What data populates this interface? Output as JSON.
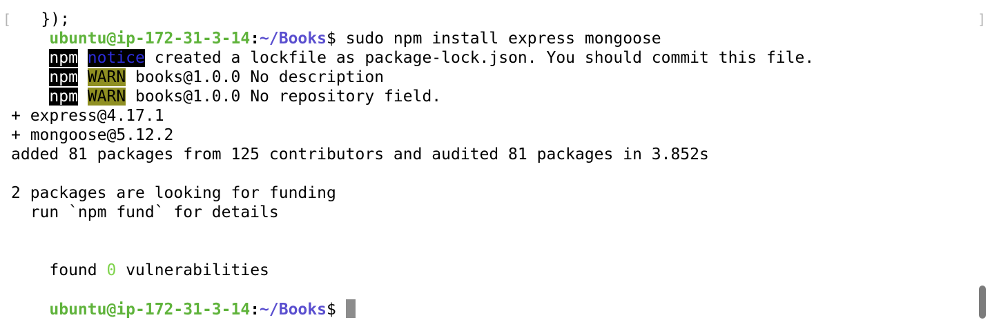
{
  "terminal": {
    "partial_top": "});",
    "prompt": {
      "user_host": "ubuntu@ip-172-31-3-14",
      "sep": ":",
      "path": "~/Books",
      "symbol": "$"
    },
    "command": " sudo npm install express mongoose",
    "npm_lines": [
      {
        "tag": "npm",
        "level": "notice",
        "text": " created a lockfile as package-lock.json. You should commit this file."
      },
      {
        "tag": "npm",
        "level": "WARN",
        "text": " books@1.0.0 No description"
      },
      {
        "tag": "npm",
        "level": "WARN",
        "text": " books@1.0.0 No repository field."
      }
    ],
    "installed": [
      "+ express@4.17.1",
      "+ mongoose@5.12.2"
    ],
    "summary": "added 81 packages from 125 contributors and audited 81 packages in 3.852s",
    "funding": [
      "2 packages are looking for funding",
      "  run `npm fund` for details"
    ],
    "found_prefix": "found ",
    "vuln_count": "0",
    "found_suffix": " vulnerabilities",
    "space": " "
  },
  "colors": {
    "prompt_user": "#5fb33b",
    "prompt_path": "#5a4fcf",
    "warn_bg": "#8f8f22",
    "notice_fg": "#2c2cd8",
    "vuln_count": "#7fd34c"
  }
}
